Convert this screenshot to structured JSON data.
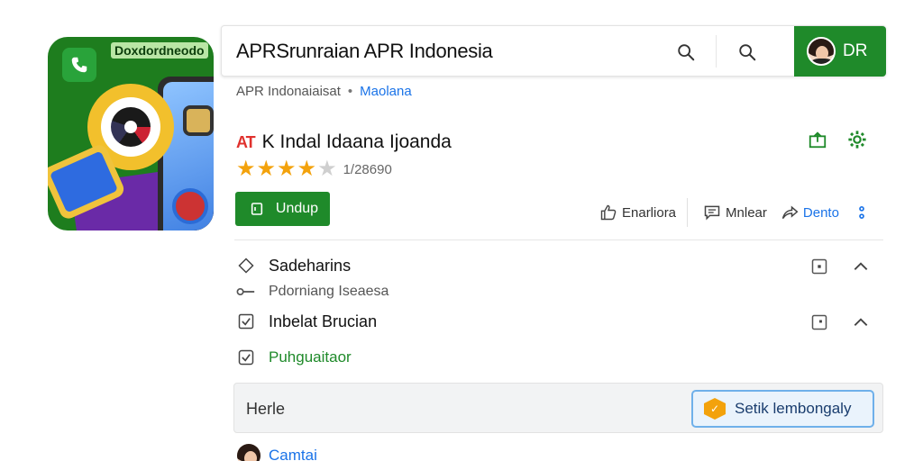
{
  "app_icon": {
    "brand_text": "Doxdordneodo"
  },
  "search": {
    "query": "APRSrunraian APR Indonesia"
  },
  "profile": {
    "initials": "DR"
  },
  "breadcrumb": {
    "category": "APR Indonaiaisat",
    "separator": "•",
    "link": "Maolana"
  },
  "app": {
    "logo_text": "AT",
    "title": "K Indal  Idaana Ijoanda",
    "rating_value": 4,
    "rating_max": 5,
    "review_count": "1/28690",
    "install_label": "Undup"
  },
  "actions": {
    "like_label": "Enarliora",
    "message_label": "Mnlear",
    "share_label": "Dento"
  },
  "rows": {
    "row1_title": "Sadeharins",
    "row1_sub": "Pdorniang Iseaesa",
    "row2_title": "Inbelat Brucian",
    "row3_title": "Puhguaitaor"
  },
  "info_bar": {
    "label": "Herle",
    "button_label": "Setik lembongaly"
  },
  "comment": {
    "label": "Camtai"
  },
  "colors": {
    "green": "#1f8a2a",
    "link_blue": "#1a73e8",
    "star": "#f3a20c"
  }
}
